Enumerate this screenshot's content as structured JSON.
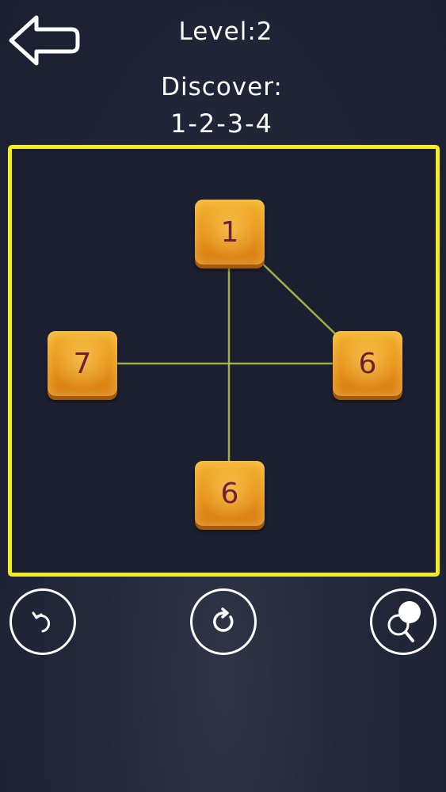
{
  "header": {
    "level_text": "Level:2",
    "goal_label": "Discover:",
    "goal_sequence": "1-2-3-4"
  },
  "board": {
    "tiles": [
      {
        "number": "1"
      },
      {
        "number": "7"
      },
      {
        "number": "6"
      },
      {
        "number": "6"
      }
    ]
  },
  "colors": {
    "board_border": "#f4ec1c",
    "connection_line": "#b8c94a",
    "tile_face": "#e6921a",
    "tile_text": "#6c1f3a",
    "background": "#22273a"
  },
  "controls": {
    "back_icon": "arrow-left-outline-icon",
    "undo_icon": "undo-icon",
    "restart_icon": "restart-icon",
    "hint_icon": "magnifier-hint-icon"
  }
}
